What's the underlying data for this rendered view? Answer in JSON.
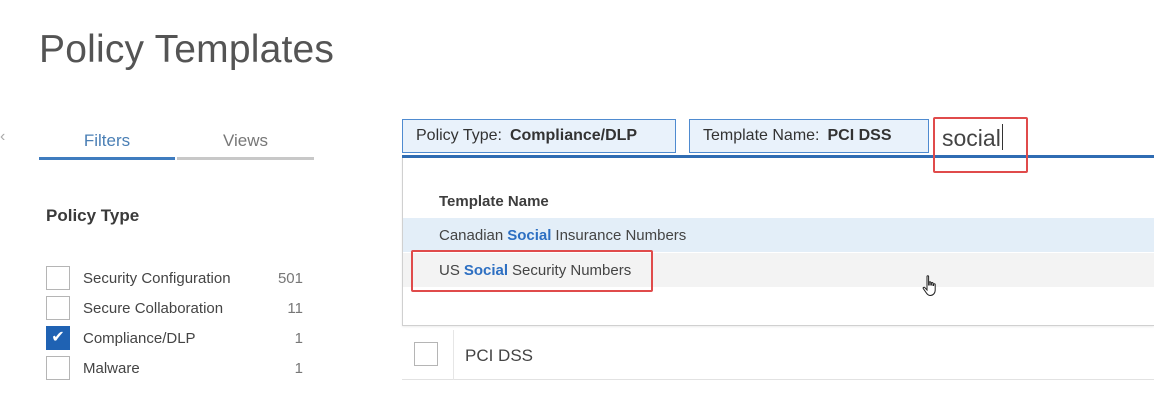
{
  "page": {
    "title": "Policy Templates"
  },
  "tabs": {
    "filters": "Filters",
    "views": "Views"
  },
  "left_edge_mark": "‹",
  "filters": {
    "heading": "Policy Type",
    "items": [
      {
        "label": "Security Configuration",
        "count": "501",
        "checked": false
      },
      {
        "label": "Secure Collaboration",
        "count": "11",
        "checked": false
      },
      {
        "label": "Compliance/DLP",
        "count": "1",
        "checked": true
      },
      {
        "label": "Malware",
        "count": "1",
        "checked": false
      }
    ]
  },
  "search": {
    "chips": [
      {
        "key": "Policy Type:",
        "value": "Compliance/DLP"
      },
      {
        "key": "Template Name:",
        "value": "PCI DSS"
      }
    ],
    "input_value": "social"
  },
  "dropdown": {
    "header": "Template Name",
    "results": [
      {
        "before": "Canadian",
        "match": "Social",
        "after": "Insurance Numbers"
      },
      {
        "before": "US",
        "match": "Social",
        "after": "Security Numbers"
      }
    ]
  },
  "table": {
    "rows": [
      {
        "name": "PCI DSS"
      }
    ]
  },
  "colors": {
    "accent": "#2f6cb3",
    "chip_bg": "#e9f2fb",
    "checkbox_checked": "#1f62b3",
    "highlight_annotation": "#e04b4b",
    "match_text": "#2d6fc2"
  },
  "icons": {
    "cursor": "hand-pointer-icon",
    "check": "checkmark-icon"
  }
}
